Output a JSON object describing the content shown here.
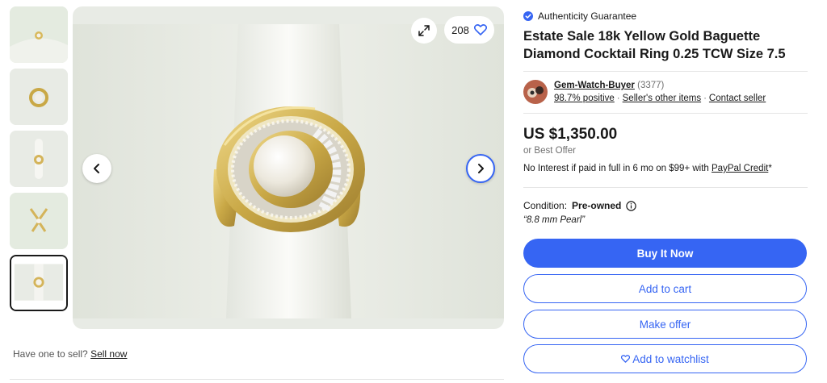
{
  "gallery": {
    "watch_count": "208",
    "thumbnail_count": 5,
    "selected_thumbnail": 5
  },
  "sell": {
    "prompt": "Have one to sell?",
    "link": "Sell now"
  },
  "listing": {
    "authenticity": "Authenticity Guarantee",
    "title": "Estate Sale 18k Yellow Gold Baguette Diamond Cocktail Ring 0.25 TCW Size 7.5",
    "seller": {
      "name": "Gem-Watch-Buyer",
      "feedback_count": "(3377)",
      "positive": "98.7% positive",
      "other_items": "Seller's other items",
      "contact": "Contact seller"
    },
    "price": "US $1,350.00",
    "best_offer": "or Best Offer",
    "credit_text": "No Interest if paid in full in 6 mo on $99+ with",
    "credit_link": "PayPal Credit",
    "credit_suffix": "*",
    "condition_label": "Condition:",
    "condition_value": "Pre-owned",
    "condition_note": "“8.8 mm Pearl”",
    "buttons": {
      "buy_now": "Buy It Now",
      "add_to_cart": "Add to cart",
      "make_offer": "Make offer",
      "watchlist": "Add to watchlist"
    }
  },
  "colors": {
    "accent": "#3665f3",
    "text": "#191919",
    "muted": "#707070",
    "gold": "#c9a846"
  }
}
